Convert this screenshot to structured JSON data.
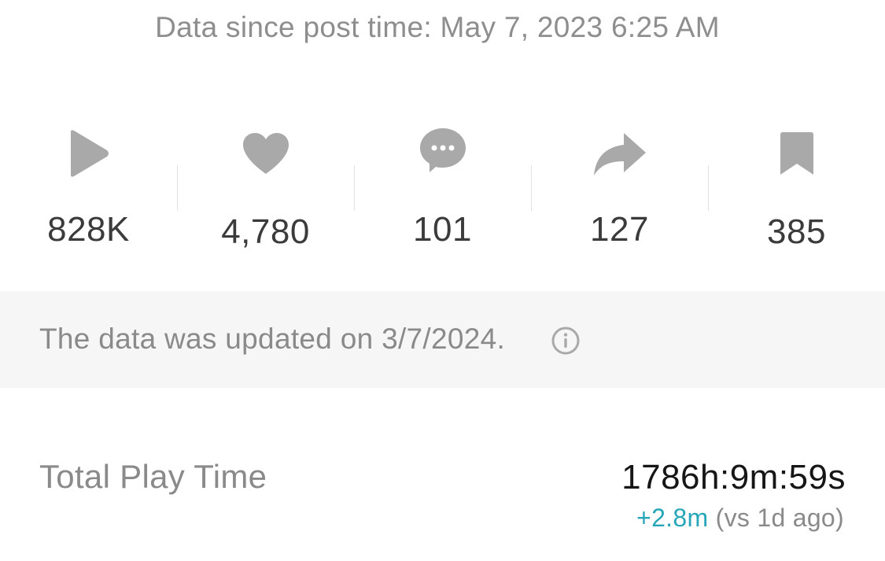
{
  "header": {
    "post_time_text": "Data since post time: May 7, 2023 6:25 AM"
  },
  "stats": {
    "plays": {
      "icon": "play-icon",
      "value": "828K"
    },
    "likes": {
      "icon": "heart-icon",
      "value": "4,780"
    },
    "comments": {
      "icon": "comment-icon",
      "value": "101"
    },
    "shares": {
      "icon": "share-icon",
      "value": "127"
    },
    "saves": {
      "icon": "bookmark-icon",
      "value": "385"
    }
  },
  "update_notice": {
    "text": "The data was updated on 3/7/2024.",
    "icon": "info-icon"
  },
  "total_play_time": {
    "label": "Total Play Time",
    "value": "1786h:9m:59s",
    "delta": "+2.8m",
    "comparison": "(vs 1d ago)"
  },
  "colors": {
    "icon_gray": "#a9a9a9",
    "value_text": "#3b3b3b",
    "muted_text": "#8a8a8a",
    "band_background": "#f6f6f6",
    "delta_teal": "#26a6b8"
  }
}
